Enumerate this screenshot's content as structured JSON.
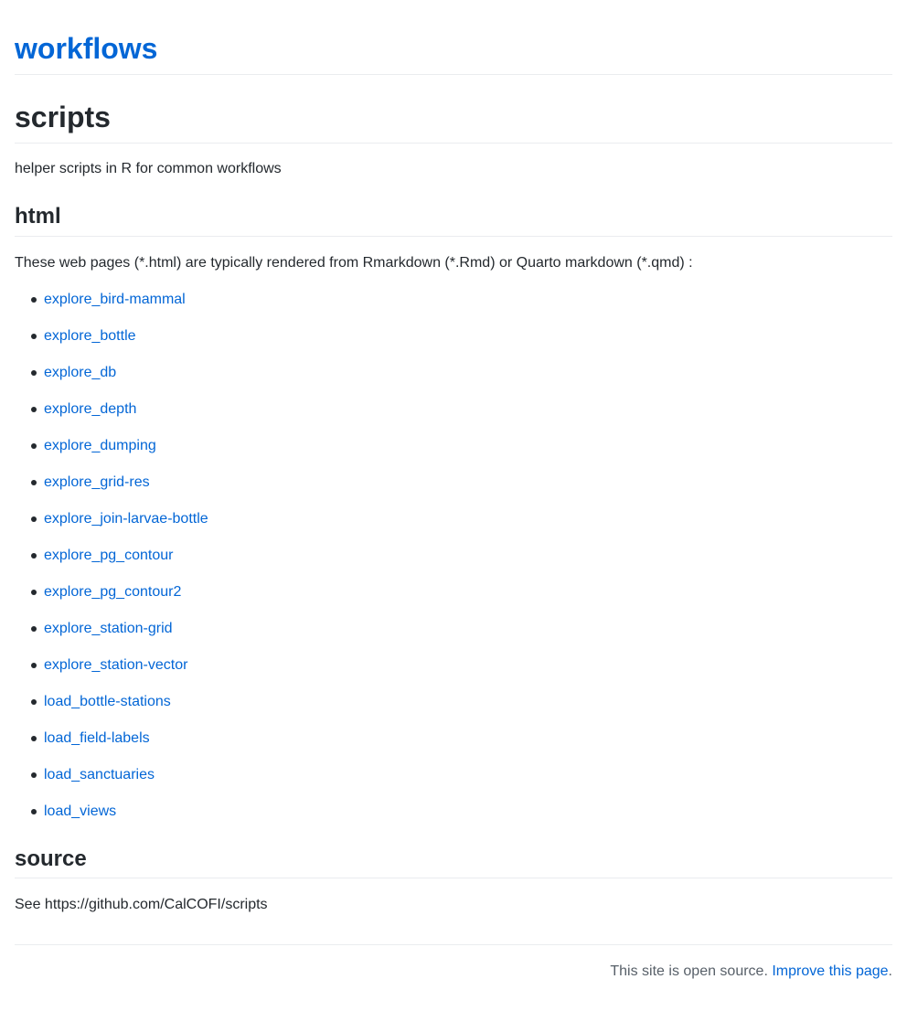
{
  "site": {
    "title": "workflows"
  },
  "page": {
    "title": "scripts",
    "intro": "helper scripts in R for common workflows"
  },
  "html_section": {
    "heading": "html",
    "description": "These web pages (*.html) are typically rendered from Rmarkdown (*.Rmd) or Quarto markdown (*.qmd) :",
    "links": [
      "explore_bird-mammal",
      "explore_bottle",
      "explore_db",
      "explore_depth",
      "explore_dumping",
      "explore_grid-res",
      "explore_join-larvae-bottle",
      "explore_pg_contour",
      "explore_pg_contour2",
      "explore_station-grid",
      "explore_station-vector",
      "load_bottle-stations",
      "load_field-labels",
      "load_sanctuaries",
      "load_views"
    ]
  },
  "source_section": {
    "heading": "source",
    "text": "See https://github.com/CalCOFI/scripts"
  },
  "footer": {
    "text": "This site is open source.",
    "link": "Improve this page",
    "end": "."
  },
  "colors": {
    "link": "#0366d6",
    "text": "#24292e",
    "muted": "#586069",
    "rule": "#eaecef"
  }
}
